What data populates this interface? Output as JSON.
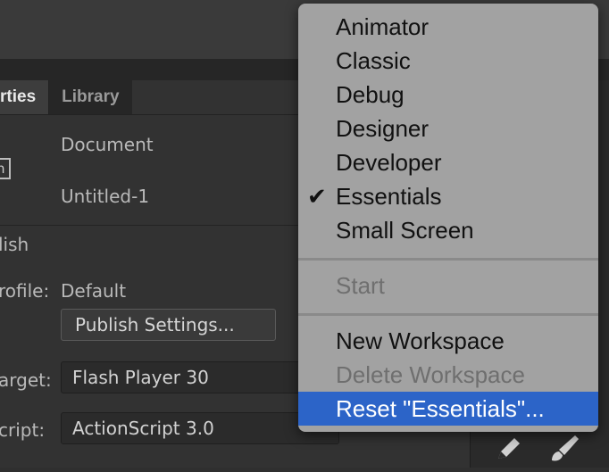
{
  "panel": {
    "tabs": [
      {
        "label": "rties",
        "active": true
      },
      {
        "label": "Library",
        "active": false
      }
    ],
    "document_label": "Document",
    "document_name": "Untitled-1",
    "doc_icon_letter": "n",
    "publish_section": "lish",
    "profile_label": "rofile:",
    "profile_value": "Default",
    "publish_settings_button": "Publish Settings...",
    "target_label": "arget:",
    "target_value": "Flash Player 30",
    "script_label": "cript:",
    "script_value": "ActionScript 3.0"
  },
  "tools": {
    "pencil_icon": "pencil-icon",
    "brush_icon": "brush-icon"
  },
  "menu": {
    "items": [
      {
        "label": "Animator",
        "checked": false,
        "disabled": false,
        "highlighted": false
      },
      {
        "label": "Classic",
        "checked": false,
        "disabled": false,
        "highlighted": false
      },
      {
        "label": "Debug",
        "checked": false,
        "disabled": false,
        "highlighted": false
      },
      {
        "label": "Designer",
        "checked": false,
        "disabled": false,
        "highlighted": false
      },
      {
        "label": "Developer",
        "checked": false,
        "disabled": false,
        "highlighted": false
      },
      {
        "label": "Essentials",
        "checked": true,
        "disabled": false,
        "highlighted": false
      },
      {
        "label": "Small Screen",
        "checked": false,
        "disabled": false,
        "highlighted": false
      },
      {
        "label": "Start",
        "checked": false,
        "disabled": true,
        "highlighted": false
      },
      {
        "label": "New Workspace",
        "checked": false,
        "disabled": false,
        "highlighted": false
      },
      {
        "label": "Delete Workspace",
        "checked": false,
        "disabled": true,
        "highlighted": false
      },
      {
        "label": "Reset \"Essentials\"...",
        "checked": false,
        "disabled": false,
        "highlighted": true
      }
    ],
    "check_glyph": "✔"
  },
  "colors": {
    "highlight": "#2c64c8",
    "menu_bg": "#a2a2a2"
  }
}
